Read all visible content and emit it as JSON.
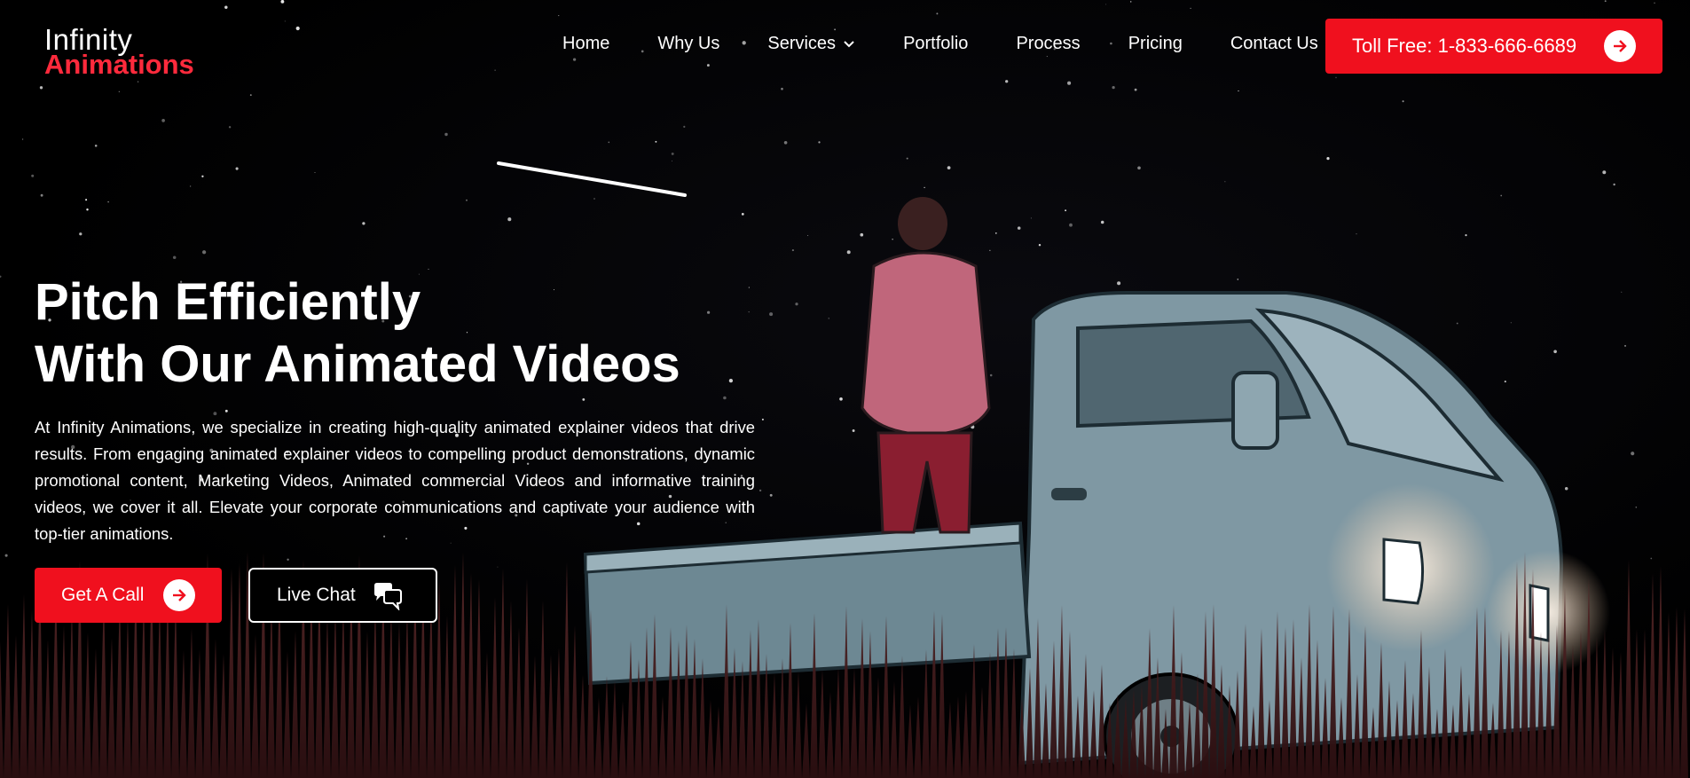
{
  "brand": {
    "line1": "Infinity",
    "line2": "Animations"
  },
  "nav": {
    "items": [
      {
        "label": "Home"
      },
      {
        "label": "Why Us"
      },
      {
        "label": "Services",
        "has_dropdown": true
      },
      {
        "label": "Portfolio"
      },
      {
        "label": "Process"
      },
      {
        "label": "Pricing"
      },
      {
        "label": "Contact Us"
      }
    ],
    "toll_free": "Toll Free: 1-833-666-6689"
  },
  "hero": {
    "title_line1": "Pitch Efficiently",
    "title_line2": "With Our Animated Videos",
    "body": "At Infinity Animations, we specialize in creating high-quality animated explainer videos that drive results. From engaging animated explainer videos to compelling product demonstrations, dynamic promotional content, Marketing Videos, Animated commercial Videos and informative training videos, we cover it all. Elevate your corporate communications and captivate your audience with top-tier animations.",
    "cta_call": "Get A Call",
    "cta_chat": "Live Chat"
  },
  "colors": {
    "accent": "#f0101e",
    "logo_red": "#ff2a3c",
    "background": "#000000"
  },
  "icons": {
    "arrow": "arrow-right-icon",
    "chat": "chat-bubbles-icon",
    "dropdown": "chevron-down-icon"
  }
}
